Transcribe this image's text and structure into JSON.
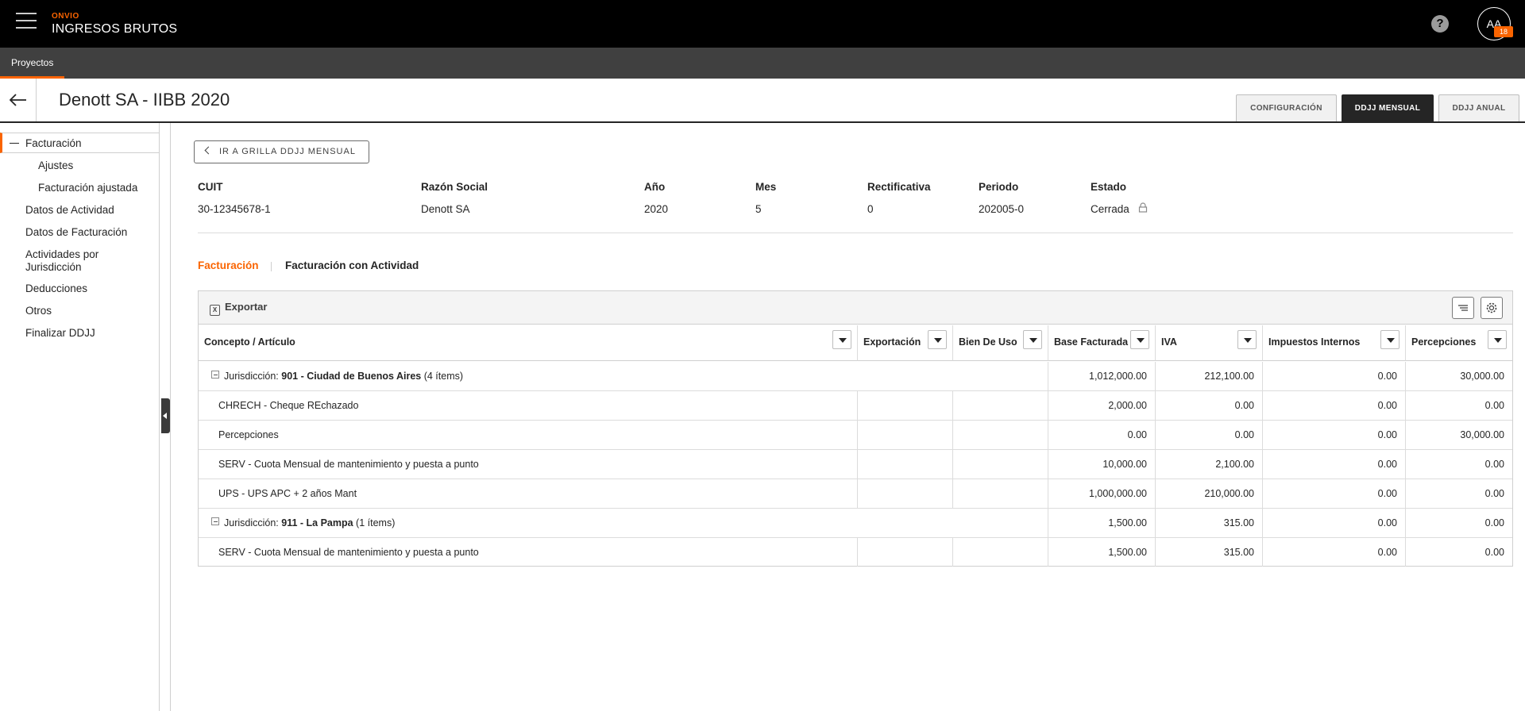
{
  "app": {
    "brand_small": "ONVIO",
    "brand_name": "INGRESOS BRUTOS",
    "help_icon": "?",
    "user_initials": "AA",
    "user_badge": "18"
  },
  "subnav": {
    "tab": "Proyectos"
  },
  "header": {
    "title": "Denott SA - IIBB 2020",
    "tabs": [
      {
        "label": "CONFIGURACIÓN"
      },
      {
        "label": "DDJJ MENSUAL"
      },
      {
        "label": "DDJJ ANUAL"
      }
    ]
  },
  "sidebar": {
    "items": [
      {
        "label": "Facturación"
      },
      {
        "label": "Ajustes"
      },
      {
        "label": "Facturación ajustada"
      },
      {
        "label": "Datos de Actividad"
      },
      {
        "label": "Datos de Facturación"
      },
      {
        "label": "Actividades por Jurisdicción"
      },
      {
        "label": "Deducciones"
      },
      {
        "label": "Otros"
      },
      {
        "label": "Finalizar DDJJ"
      }
    ]
  },
  "main": {
    "goto_button": "IR A GRILLA DDJJ MENSUAL",
    "info": {
      "cuit_label": "CUIT",
      "cuit": "30-12345678-1",
      "razon_label": "Razón Social",
      "razon": "Denott SA",
      "anio_label": "Año",
      "anio": "2020",
      "mes_label": "Mes",
      "mes": "5",
      "rect_label": "Rectificativa",
      "rect": "0",
      "periodo_label": "Periodo",
      "periodo": "202005-0",
      "estado_label": "Estado",
      "estado": "Cerrada"
    },
    "subtabs": [
      {
        "label": "Facturación"
      },
      {
        "label": "Facturación con Actividad"
      }
    ]
  },
  "grid": {
    "export_label": "Exportar",
    "columns": [
      "Concepto / Artículo",
      "Exportación",
      "Bien De Uso",
      "Base Facturada",
      "IVA",
      "Impuestos Internos",
      "Percepciones"
    ],
    "groups": [
      {
        "prefix": "Jurisdicción: ",
        "name": "901 - Ciudad de Buenos Aires",
        "count": " (4 ítems)",
        "base": "1,012,000.00",
        "iva": "212,100.00",
        "internos": "0.00",
        "percepciones": "30,000.00",
        "rows": [
          {
            "concepto": "CHRECH - Cheque REchazado",
            "base": "2,000.00",
            "iva": "0.00",
            "internos": "0.00",
            "percepciones": "0.00"
          },
          {
            "concepto": "Percepciones",
            "base": "0.00",
            "iva": "0.00",
            "internos": "0.00",
            "percepciones": "30,000.00"
          },
          {
            "concepto": "SERV - Cuota Mensual de mantenimiento y puesta a punto",
            "base": "10,000.00",
            "iva": "2,100.00",
            "internos": "0.00",
            "percepciones": "0.00"
          },
          {
            "concepto": "UPS - UPS APC + 2 años Mant",
            "base": "1,000,000.00",
            "iva": "210,000.00",
            "internos": "0.00",
            "percepciones": "0.00"
          }
        ]
      },
      {
        "prefix": "Jurisdicción: ",
        "name": "911 - La Pampa",
        "count": " (1 ítems)",
        "base": "1,500.00",
        "iva": "315.00",
        "internos": "0.00",
        "percepciones": "0.00",
        "rows": [
          {
            "concepto": "SERV - Cuota Mensual de mantenimiento y puesta a punto",
            "base": "1,500.00",
            "iva": "315.00",
            "internos": "0.00",
            "percepciones": "0.00"
          }
        ]
      }
    ]
  },
  "colors": {
    "accent": "#fa6400",
    "topbar": "#000000",
    "subnav": "#404040"
  }
}
